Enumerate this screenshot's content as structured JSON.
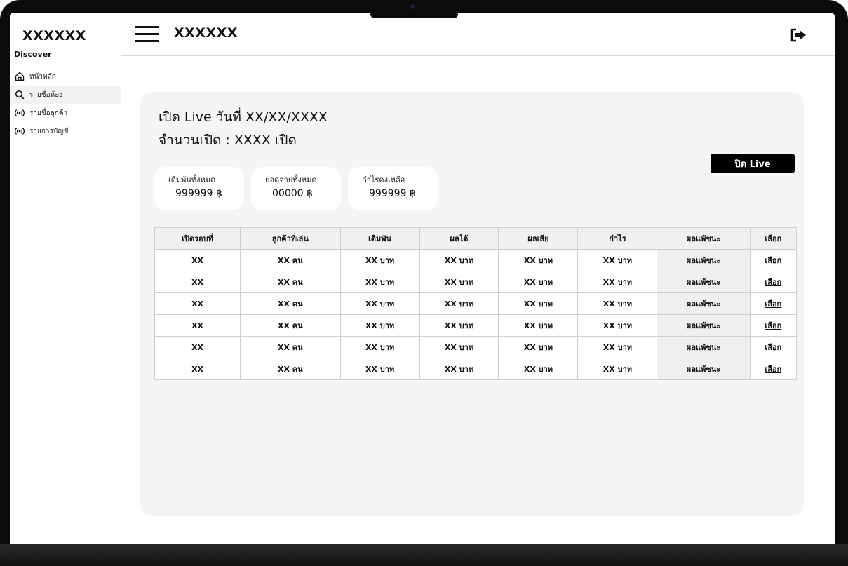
{
  "sidebar": {
    "brand": "XXXXXX",
    "section": "Discover",
    "items": [
      {
        "label": "หน้าหลัก",
        "icon": "home-icon"
      },
      {
        "label": "รายชื่อห้อง",
        "icon": "search-icon"
      },
      {
        "label": "รายชื่อลูกค้า",
        "icon": "broadcast-icon"
      },
      {
        "label": "รายการบัญชี",
        "icon": "broadcast-icon"
      }
    ]
  },
  "topbar": {
    "title": "XXXXXX",
    "menu_icon": "hamburger-icon",
    "logout_icon": "logout-icon"
  },
  "main": {
    "heading_line1": "เปิด Live วันที่ XX/XX/XXXX",
    "heading_line2": "จำนวนเปิด : XXXX เปิด",
    "close_button": "ปิด Live",
    "stats": [
      {
        "label": "เดิมพันทั้งหมด",
        "value": "999999 ฿"
      },
      {
        "label": "ยอดจ่ายทั้งหมด",
        "value": "00000 ฿"
      },
      {
        "label": "กำไรคงเหลือ",
        "value": "999999 ฿"
      }
    ],
    "table": {
      "headers": [
        "เปิดรอบที่",
        "ลูกค้าที่เล่น",
        "เดิมพัน",
        "ผลได้",
        "ผลเสีย",
        "กำไร",
        "ผลแพ้ชนะ",
        "เลือก"
      ],
      "rows": [
        [
          "XX",
          "XX คน",
          "XX บาท",
          "XX บาท",
          "XX บาท",
          "XX บาท",
          "ผลแพ้ชนะ",
          "เลือก"
        ],
        [
          "XX",
          "XX คน",
          "XX บาท",
          "XX บาท",
          "XX บาท",
          "XX บาท",
          "ผลแพ้ชนะ",
          "เลือก"
        ],
        [
          "XX",
          "XX คน",
          "XX บาท",
          "XX บาท",
          "XX บาท",
          "XX บาท",
          "ผลแพ้ชนะ",
          "เลือก"
        ],
        [
          "XX",
          "XX คน",
          "XX บาท",
          "XX บาท",
          "XX บาท",
          "XX บาท",
          "ผลแพ้ชนะ",
          "เลือก"
        ],
        [
          "XX",
          "XX คน",
          "XX บาท",
          "XX บาท",
          "XX บาท",
          "XX บาท",
          "ผลแพ้ชนะ",
          "เลือก"
        ],
        [
          "XX",
          "XX คน",
          "XX บาท",
          "XX บาท",
          "XX บาท",
          "XX บาท",
          "ผลแพ้ชนะ",
          "เลือก"
        ]
      ]
    }
  }
}
